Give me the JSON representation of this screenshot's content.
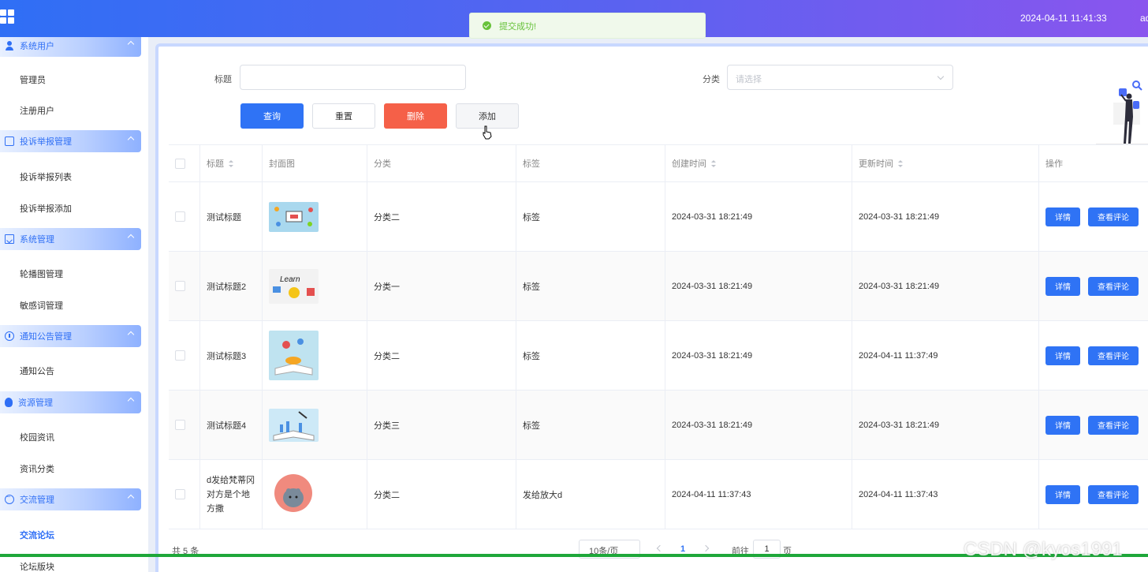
{
  "header": {
    "datetime": "2024-04-11 11:41:33",
    "user": "admin"
  },
  "toast": {
    "message": "提交成功!"
  },
  "sidebar": {
    "groups": [
      {
        "label": "系统用户",
        "items": [
          "管理员",
          "注册用户"
        ]
      },
      {
        "label": "投诉举报管理",
        "items": [
          "投诉举报列表",
          "投诉举报添加"
        ]
      },
      {
        "label": "系统管理",
        "items": [
          "轮播图管理",
          "敏感词管理"
        ]
      },
      {
        "label": "通知公告管理",
        "items": [
          "通知公告"
        ]
      },
      {
        "label": "资源管理",
        "items": [
          "校园资讯",
          "资讯分类"
        ]
      },
      {
        "label": "交流管理",
        "items": [
          "交流论坛",
          "论坛版块"
        ]
      }
    ]
  },
  "search": {
    "title_label": "标题",
    "title_value": "",
    "category_label": "分类",
    "category_placeholder": "请选择"
  },
  "buttons": {
    "query": "查询",
    "reset": "重置",
    "delete": "删除",
    "add": "添加"
  },
  "table": {
    "headers": [
      "标题",
      "封面图",
      "分类",
      "标签",
      "创建时间",
      "更新时间",
      "操作"
    ],
    "action_detail": "详情",
    "action_comments": "查看评论",
    "rows": [
      {
        "title": "测试标题",
        "category": "分类二",
        "tag": "标签",
        "created": "2024-03-31 18:21:49",
        "updated": "2024-03-31 18:21:49"
      },
      {
        "title": "测试标题2",
        "category": "分类一",
        "tag": "标签",
        "created": "2024-03-31 18:21:49",
        "updated": "2024-03-31 18:21:49"
      },
      {
        "title": "测试标题3",
        "category": "分类二",
        "tag": "标签",
        "created": "2024-03-31 18:21:49",
        "updated": "2024-04-11 11:37:49"
      },
      {
        "title": "测试标题4",
        "category": "分类三",
        "tag": "标签",
        "created": "2024-03-31 18:21:49",
        "updated": "2024-03-31 18:21:49"
      },
      {
        "title": "d发给梵蒂冈对方是个地方撒",
        "category": "分类二",
        "tag": "发给放大d",
        "created": "2024-04-11 11:37:43",
        "updated": "2024-04-11 11:37:43"
      }
    ]
  },
  "pagination": {
    "total": "共 5 条",
    "page_size": "10条/页",
    "current_page": "1",
    "goto_prefix": "前往",
    "goto_value": "1",
    "goto_suffix": "页"
  },
  "watermark": "CSDN @kyos1991"
}
